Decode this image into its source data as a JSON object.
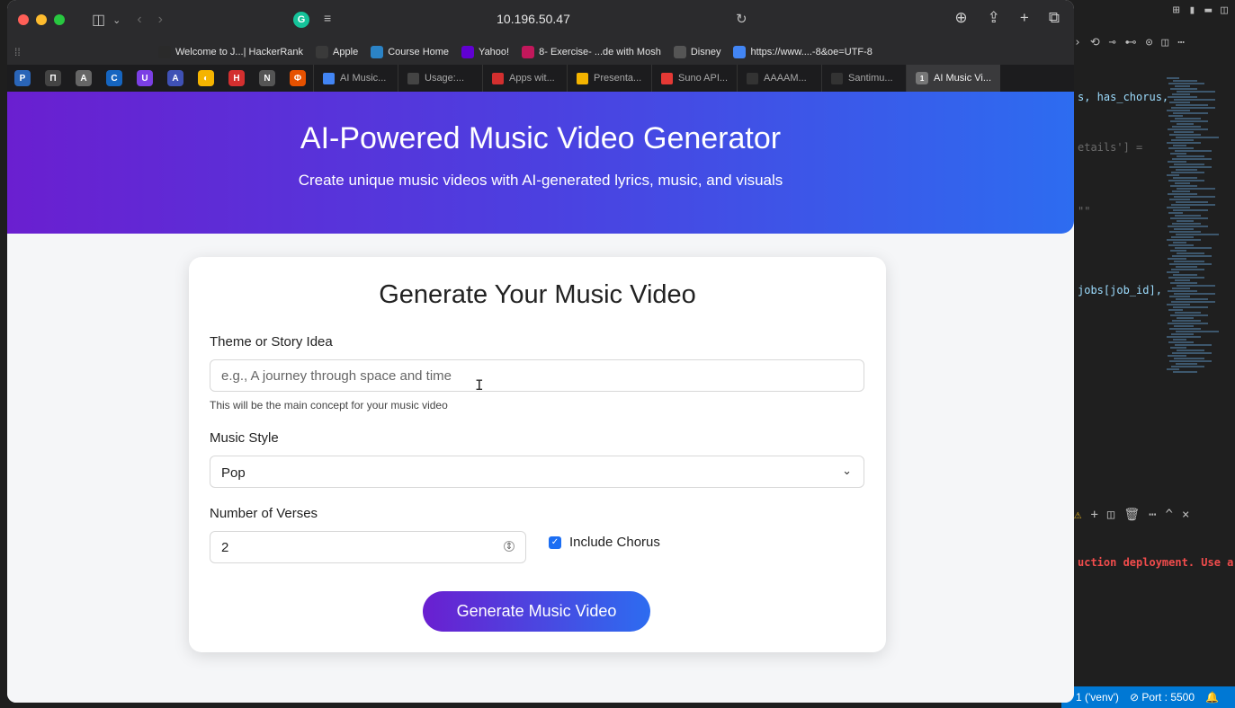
{
  "browser": {
    "address": "10.196.50.47",
    "favorites": [
      {
        "label": "Welcome to J...| HackerRank",
        "icon": "hackerrank-icon",
        "color": "#2a2a2a"
      },
      {
        "label": "Apple",
        "icon": "apple-icon",
        "color": "#3a3a3a"
      },
      {
        "label": "Course Home",
        "icon": "course-icon",
        "color": "#2b83c6"
      },
      {
        "label": "Yahoo!",
        "icon": "yahoo-icon",
        "color": "#6001d2"
      },
      {
        "label": "8- Exercise- ...de with Mosh",
        "icon": "mosh-icon",
        "color": "#c2185b"
      },
      {
        "label": "Disney",
        "icon": "disney-icon",
        "color": "#555"
      },
      {
        "label": "https://www....-8&oe=UTF-8",
        "icon": "google-icon",
        "color": "#4285f4"
      }
    ],
    "tabs": [
      {
        "label": "AI Music...",
        "color": "#4285f4"
      },
      {
        "label": "Usage:...",
        "color": "#444"
      },
      {
        "label": "Apps wit...",
        "color": "#d32f2f"
      },
      {
        "label": "Presenta...",
        "color": "#f4b400"
      },
      {
        "label": "Suno API...",
        "color": "#e53935"
      },
      {
        "label": "AAAAM...",
        "color": "#333"
      },
      {
        "label": "Santimu...",
        "color": "#333"
      }
    ],
    "active_tab": "AI Music Vi...",
    "active_tab_badge": "1"
  },
  "hero": {
    "title": "AI-Powered Music Video Generator",
    "subtitle": "Create unique music videos with AI-generated lyrics, music, and visuals"
  },
  "form": {
    "heading": "Generate Your Music Video",
    "theme_label": "Theme or Story Idea",
    "theme_placeholder": "e.g., A journey through space and time",
    "theme_value": "",
    "theme_hint": "This will be the main concept for your music video",
    "style_label": "Music Style",
    "style_value": "Pop",
    "verses_label": "Number of Verses",
    "verses_value": "2",
    "chorus_label": "Include Chorus",
    "chorus_checked": true,
    "submit_label": "Generate Music Video"
  },
  "vscode": {
    "code_lines": [
      "s, has_chorus,",
      "etails'] =",
      "\"\"",
      "jobs[job_id],"
    ],
    "error_text": "uction deployment. Use a",
    "status_env": "1 ('venv')",
    "status_port": "⊘ Port : 5500"
  },
  "colors": {
    "accent_start": "#6a1fd0",
    "accent_end": "#2d6cf0",
    "checkbox": "#1c6ef3"
  }
}
